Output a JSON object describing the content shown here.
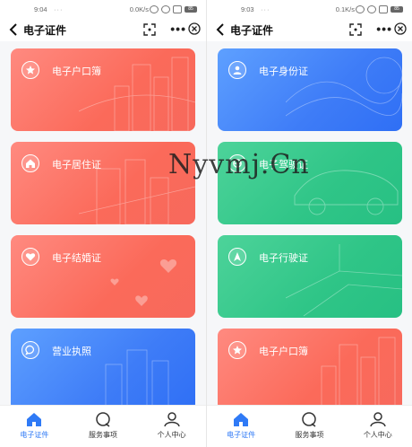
{
  "left": {
    "status": {
      "time": "9:04",
      "dots": "···",
      "speed": "0.0K/s",
      "battery": "85"
    },
    "nav": {
      "title": "电子证件"
    },
    "cards": [
      {
        "label": "电子户口簿",
        "icon": "star-badge-icon",
        "theme": "red"
      },
      {
        "label": "电子居住证",
        "icon": "house-icon",
        "theme": "red"
      },
      {
        "label": "电子结婚证",
        "icon": "heart-icon",
        "theme": "red"
      },
      {
        "label": "营业执照",
        "icon": "chat-bubble-icon",
        "theme": "blue"
      }
    ],
    "tabs": [
      {
        "label": "电子证件",
        "icon": "home-icon",
        "active": true
      },
      {
        "label": "服务事项",
        "icon": "service-icon",
        "active": false
      },
      {
        "label": "个人中心",
        "icon": "user-icon",
        "active": false
      }
    ]
  },
  "right": {
    "status": {
      "time": "9:03",
      "dots": "···",
      "speed": "0.1K/s",
      "battery": "85"
    },
    "nav": {
      "title": "电子证件"
    },
    "cards": [
      {
        "label": "电子身份证",
        "icon": "person-icon",
        "theme": "blue"
      },
      {
        "label": "电子驾驶证",
        "icon": "steering-wheel-icon",
        "theme": "green"
      },
      {
        "label": "电子行驶证",
        "icon": "navigation-arrow-icon",
        "theme": "green"
      },
      {
        "label": "电子户口簿",
        "icon": "star-badge-icon",
        "theme": "red"
      }
    ],
    "tabs": [
      {
        "label": "电子证件",
        "icon": "home-icon",
        "active": true
      },
      {
        "label": "服务事项",
        "icon": "service-icon",
        "active": false
      },
      {
        "label": "个人中心",
        "icon": "user-icon",
        "active": false
      }
    ]
  },
  "watermark": "Nyvmj.Cn",
  "colors": {
    "accent": "#2f7af6",
    "red": "#fb6a5a",
    "blue": "#3e7cf7",
    "green": "#2fc587"
  }
}
